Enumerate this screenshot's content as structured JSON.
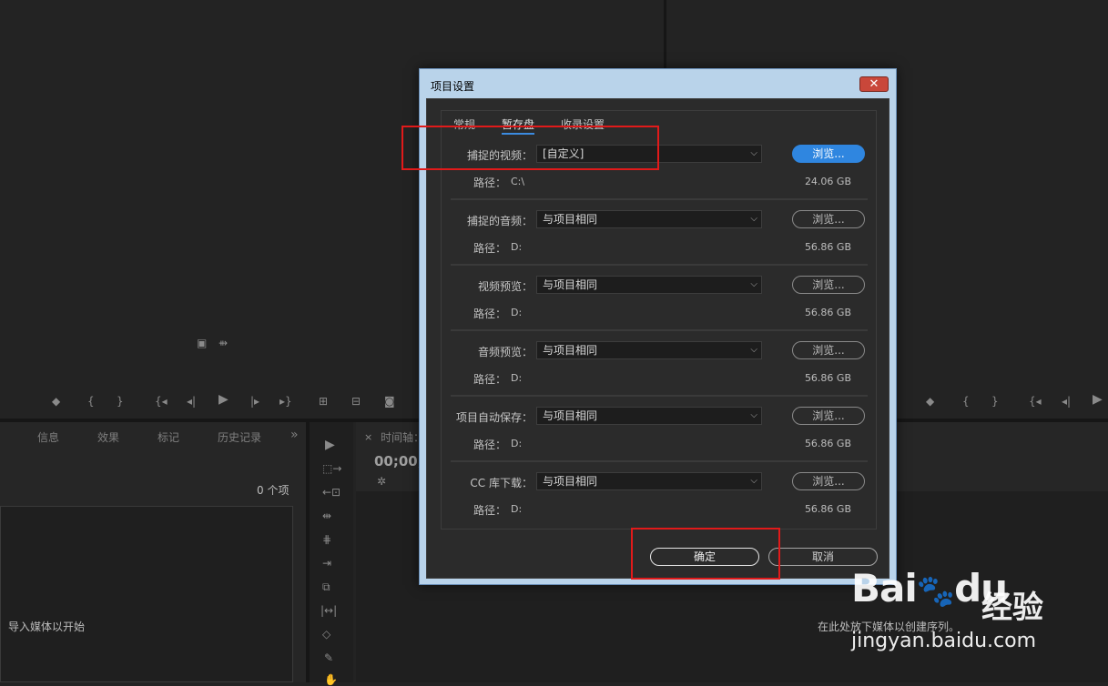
{
  "dialog": {
    "title": "项目设置",
    "close_glyph": "✕",
    "tabs": [
      {
        "label": "常规",
        "active": false
      },
      {
        "label": "暂存盘",
        "active": true
      },
      {
        "label": "收录设置",
        "active": false
      }
    ],
    "rows": [
      {
        "label": "捕捉的视频：",
        "value": "[自定义]",
        "browse": "浏览...",
        "path_label": "路径：",
        "path": "C:\\",
        "size": "24.06 GB",
        "primary": true
      },
      {
        "label": "捕捉的音频：",
        "value": "与项目相同",
        "browse": "浏览...",
        "path_label": "路径：",
        "path": "D:",
        "size": "56.86 GB",
        "primary": false
      },
      {
        "label": "视频预览：",
        "value": "与项目相同",
        "browse": "浏览...",
        "path_label": "路径：",
        "path": "D:",
        "size": "56.86 GB",
        "primary": false
      },
      {
        "label": "音频预览：",
        "value": "与项目相同",
        "browse": "浏览...",
        "path_label": "路径：",
        "path": "D:",
        "size": "56.86 GB",
        "primary": false
      },
      {
        "label": "项目自动保存：",
        "value": "与项目相同",
        "browse": "浏览...",
        "path_label": "路径：",
        "path": "D:",
        "size": "56.86 GB",
        "primary": false
      },
      {
        "label": "CC 库下载：",
        "value": "与项目相同",
        "browse": "浏览...",
        "path_label": "路径：",
        "path": "D:",
        "size": "56.86 GB",
        "primary": false
      }
    ],
    "ok_label": "确定",
    "cancel_label": "取消"
  },
  "background": {
    "bottom_tabs": [
      "信息",
      "效果",
      "标记",
      "历史记录"
    ],
    "more_glyph": "»",
    "item_count": "0 个项",
    "import_hint": "导入媒体以开始",
    "timeline_tab": "时间轴：",
    "timecode": "00;00;",
    "drop_hint": "在此处放下媒体以创建序列。"
  },
  "watermark": {
    "brand_a": "Bai",
    "brand_b": "du",
    "brand_cn": "经验",
    "url": "jingyan.baidu.com"
  },
  "colors": {
    "accent": "#2f86e0",
    "highlight": "#e11a1a"
  }
}
